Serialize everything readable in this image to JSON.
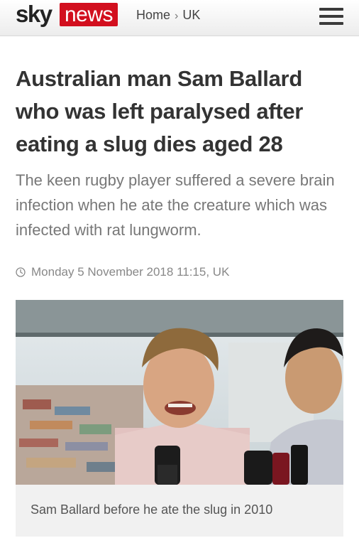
{
  "header": {
    "logo_sky": "sky",
    "logo_news": "news",
    "breadcrumb": {
      "home": "Home",
      "separator": "›",
      "section": "UK"
    },
    "menu_icon": "hamburger-menu-icon"
  },
  "article": {
    "headline": "Australian man Sam Ballard who was left paralysed after eating a slug dies aged 28",
    "standfirst": "The keen rugby player suffered a severe brain infection when he ate the creature which was infected with rat lungworm.",
    "dateline": "Monday 5 November 2018 11:15, UK",
    "image_caption": "Sam Ballard before he ate the slug in 2010"
  },
  "colors": {
    "brand_red": "#d20f1e",
    "text_dark": "#333333",
    "text_muted": "#777777",
    "caption_bg": "#f1f1f1"
  }
}
